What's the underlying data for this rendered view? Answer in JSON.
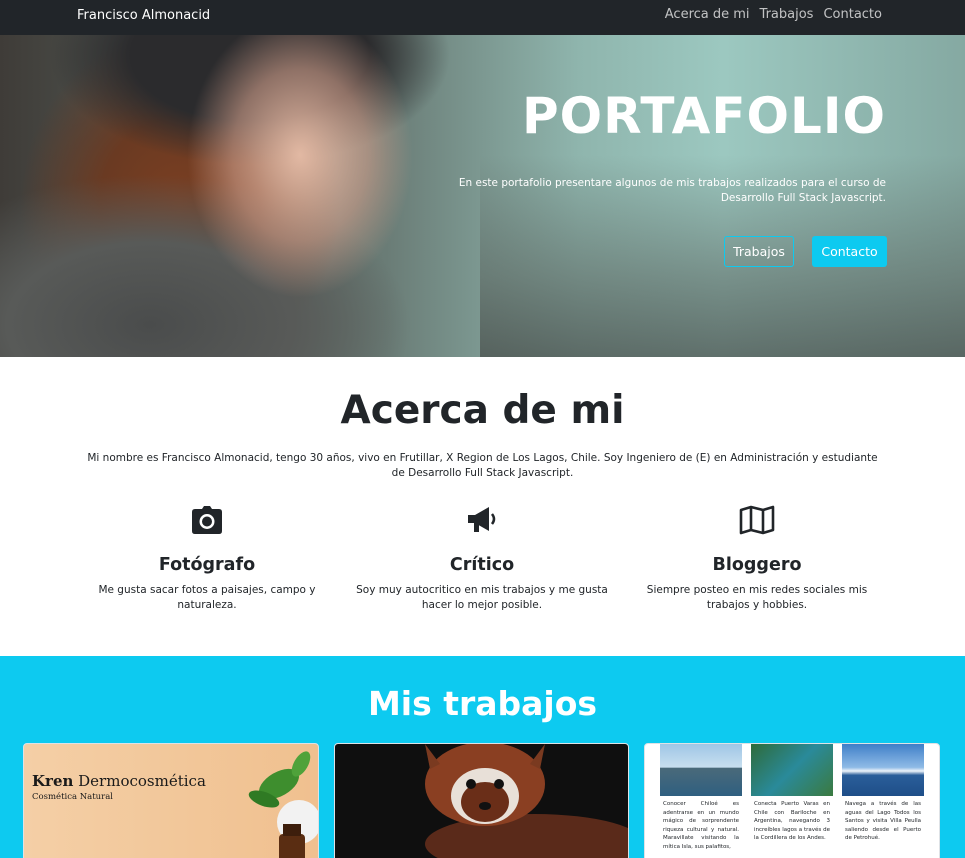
{
  "nav": {
    "brand": "Francisco Almonacid",
    "links": [
      "Acerca de mi",
      "Trabajos",
      "Contacto"
    ]
  },
  "hero": {
    "title": "PORTAFOLIO",
    "text": "En este portafolio presentare algunos de mis trabajos realizados para el curso de Desarrollo Full Stack Javascript.",
    "buttons": {
      "trabajos": "Trabajos",
      "contacto": "Contacto"
    }
  },
  "about": {
    "title": "Acerca de mi",
    "text": "Mi nombre es Francisco Almonacid, tengo 30 años, vivo en Frutillar, X Region de Los Lagos, Chile. Soy Ingeniero de (E) en Administración y estudiante de Desarrollo Full Stack Javascript.",
    "features": [
      {
        "icon": "camera-icon",
        "title": "Fotógrafo",
        "text": "Me gusta sacar fotos a paisajes, campo y naturaleza."
      },
      {
        "icon": "megaphone-icon",
        "title": "Crítico",
        "text": "Soy muy autocritico en mis trabajos y me gusta hacer lo mejor posible."
      },
      {
        "icon": "map-icon",
        "title": "Bloggero",
        "text": "Siempre posteo en mis redes sociales mis trabajos y hobbies."
      }
    ]
  },
  "works": {
    "title": "Mis trabajos",
    "card1": {
      "brand_bold": "Kren",
      "brand_rest": " Dermocosmética",
      "subtitle": "Cosmética Natural"
    },
    "card3": {
      "items": [
        "Conocer Chiloé es adentrarse en un mundo mágico de sorprendente riqueza cultural y natural. Maravillate visitando la mítica Isla, sus palafitos,",
        "Conecta Puerto Varas en Chile con Bariloche en Argentina, navegando 3 increíbles lagos a través de la Cordillera de los Andes.",
        "Navega a través de las aguas del Lago Todos los Santos y visita Villa Peulla saliendo desde el Puerto de Petrohué."
      ]
    }
  },
  "colors": {
    "navbar": "#212529",
    "accent": "#0dcaf0"
  }
}
